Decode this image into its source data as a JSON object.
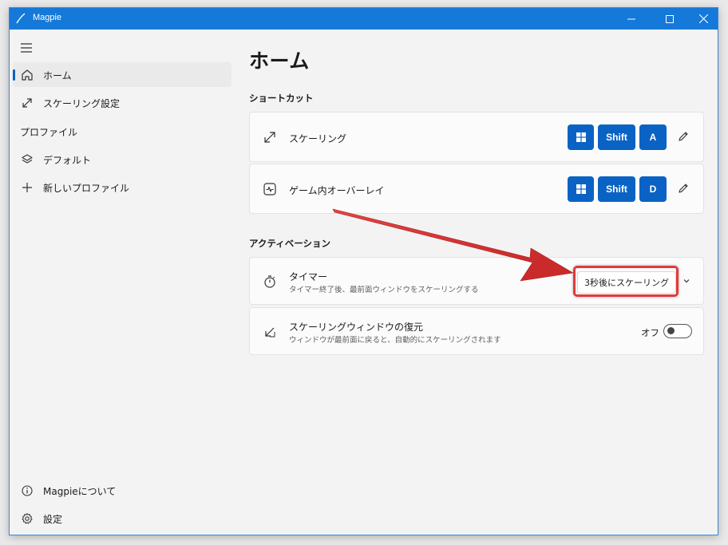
{
  "window": {
    "title": "Magpie"
  },
  "sidebar": {
    "items": [
      {
        "label": "ホーム",
        "icon": "home-icon",
        "selected": true
      },
      {
        "label": "スケーリング設定",
        "icon": "resize-icon"
      }
    ],
    "profiles_header": "プロファイル",
    "profiles": [
      {
        "label": "デフォルト",
        "icon": "layers-icon"
      },
      {
        "label": "新しいプロファイル",
        "icon": "plus-icon"
      }
    ],
    "footer": [
      {
        "label": "Magpieについて",
        "icon": "info-icon"
      },
      {
        "label": "設定",
        "icon": "gear-icon"
      }
    ]
  },
  "main": {
    "title": "ホーム",
    "shortcuts": {
      "header": "ショートカット",
      "items": [
        {
          "label": "スケーリング",
          "keys": [
            "Shift",
            "A"
          ],
          "icon": "resize-icon"
        },
        {
          "label": "ゲーム内オーバーレイ",
          "keys": [
            "Shift",
            "D"
          ],
          "icon": "pulse-icon"
        }
      ]
    },
    "activation": {
      "header": "アクティベーション",
      "timer": {
        "title": "タイマー",
        "desc": "タイマー終了後、最前面ウィンドウをスケーリングする",
        "value": "3秒後にスケーリング"
      },
      "restore": {
        "title": "スケーリングウィンドウの復元",
        "desc": "ウィンドウが最前面に戻ると、自動的にスケーリングされます",
        "state_label": "オフ",
        "on": false
      }
    }
  },
  "colors": {
    "accent": "#0a63c4",
    "titlebar": "#1479d9",
    "highlight": "#e33a3a"
  }
}
